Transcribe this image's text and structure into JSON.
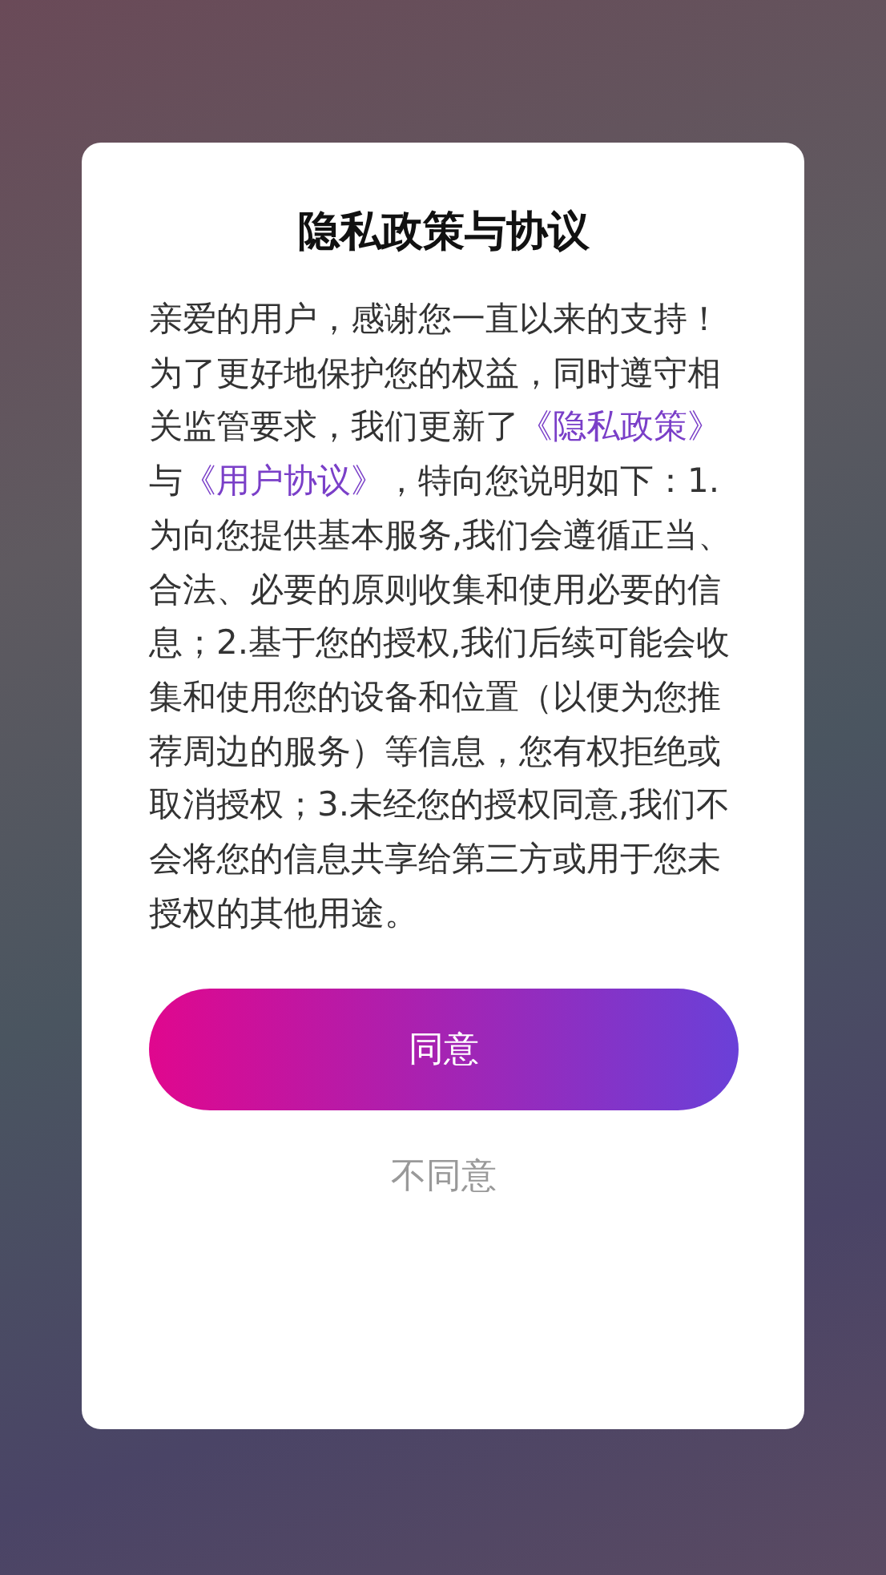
{
  "dialog": {
    "title": "隐私政策与协议",
    "intro": "亲爱的用户，感谢您一直以来的支持！",
    "body": [
      {
        "kind": "text",
        "text": " 为了更好地保护您的权益，同时遵守相关监管要求，我们更新了"
      },
      {
        "kind": "link",
        "text": "《隐私政策》"
      },
      {
        "kind": "text",
        "text": "与"
      },
      {
        "kind": "link",
        "text": "《用户协议》"
      },
      {
        "kind": "text",
        "text": "，特向您说明如下：1.为向您提供基本服务,我们会遵循正当、合法、必要的原则收集和使用必要的信息；2.基于您的授权,我们后续可能会收集和使用您的设备和位置（以便为您推荐周边的服务）等信息，您有权拒绝或取消授权；3.未经您的授权同意,我们不会将您的信息共享给第三方或用于您未授权的其他用途。"
      }
    ],
    "buttons": [
      {
        "kind": "primary",
        "label": "同意"
      },
      {
        "kind": "plain",
        "label": "不同意"
      }
    ]
  }
}
